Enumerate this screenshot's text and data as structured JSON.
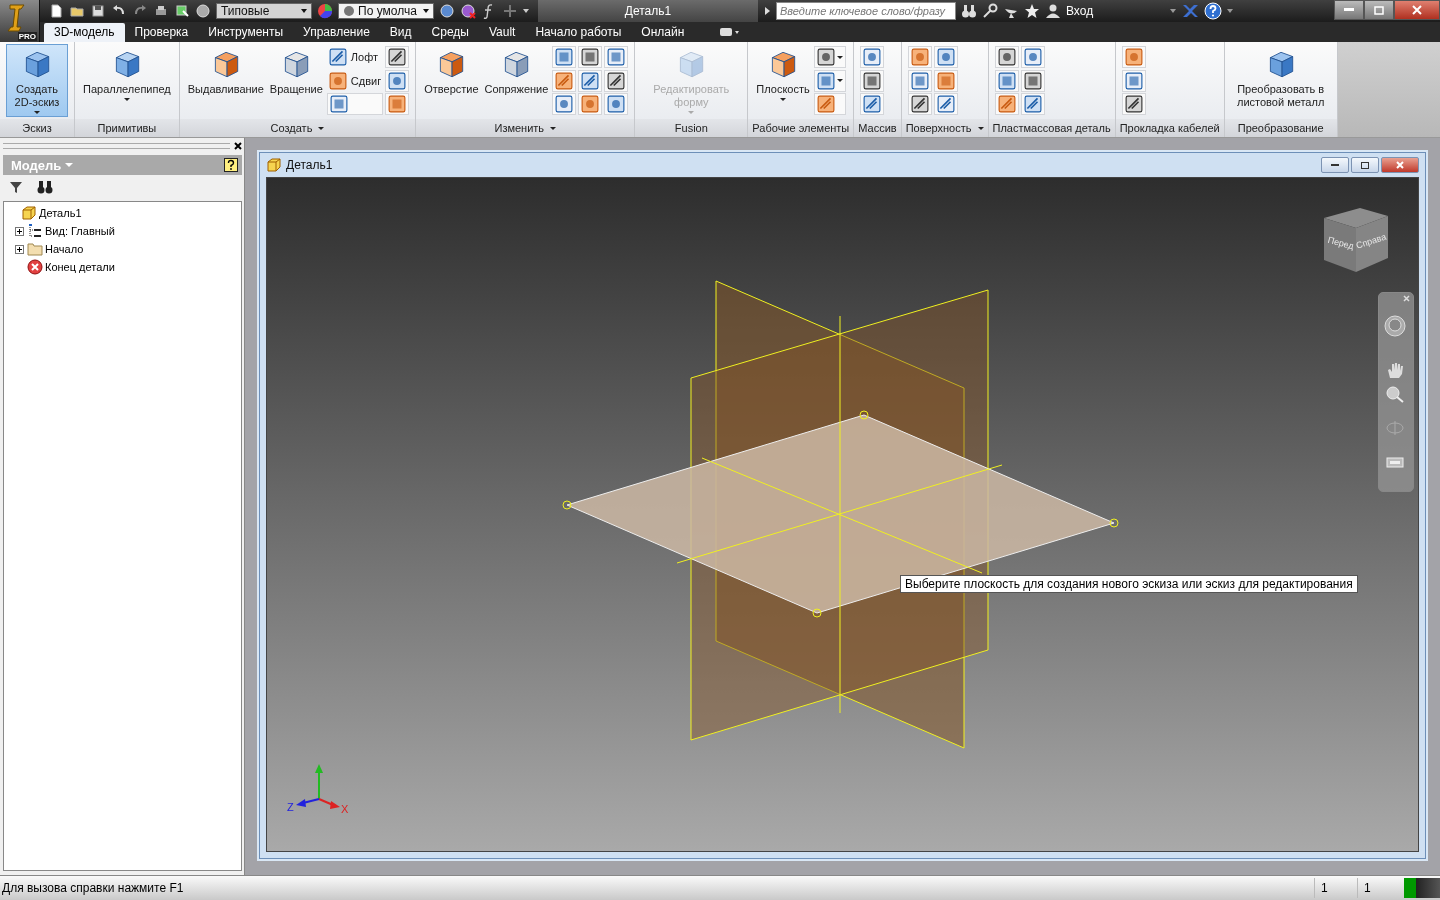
{
  "app_menu": {
    "edition": "PRO"
  },
  "quick_access": {
    "style_dropdown": "Типовые",
    "appearance_dropdown": "По умолча"
  },
  "window": {
    "title": "Деталь1"
  },
  "search": {
    "placeholder": "Введите ключевое слово/фразу"
  },
  "sign_in": "Вход",
  "tabs": [
    {
      "label": "3D-модель",
      "selected": true
    },
    {
      "label": "Проверка",
      "selected": false
    },
    {
      "label": "Инструменты",
      "selected": false
    },
    {
      "label": "Управление",
      "selected": false
    },
    {
      "label": "Вид",
      "selected": false
    },
    {
      "label": "Среды",
      "selected": false
    },
    {
      "label": "Vault",
      "selected": false
    },
    {
      "label": "Начало работы",
      "selected": false
    },
    {
      "label": "Онлайн",
      "selected": false
    }
  ],
  "ribbon": [
    {
      "title": "Эскиз",
      "menu": false,
      "items": [
        {
          "kind": "large",
          "label": "Создать 2D-эскиз",
          "selected": true,
          "disabled": false,
          "dropdown": true
        }
      ]
    },
    {
      "title": "Примитивы",
      "menu": false,
      "items": [
        {
          "kind": "large",
          "label": "Параллелепипед",
          "selected": false,
          "disabled": false,
          "dropdown": true
        }
      ]
    },
    {
      "title": "Создать",
      "menu": true,
      "items": [
        {
          "kind": "large",
          "label": "Выдавливание",
          "selected": false,
          "disabled": false,
          "dropdown": false
        },
        {
          "kind": "large",
          "label": "Вращение",
          "selected": false,
          "disabled": false,
          "dropdown": false
        },
        {
          "kind": "stack",
          "buttons": [
            {
              "kind": "labeled",
              "label": "Лофт"
            },
            {
              "kind": "labeled",
              "label": "Сдвиг"
            },
            {
              "kind": "icon"
            }
          ]
        },
        {
          "kind": "stack",
          "buttons": [
            {
              "kind": "icon"
            },
            {
              "kind": "icon"
            },
            {
              "kind": "icon"
            }
          ]
        }
      ]
    },
    {
      "title": "Изменить",
      "menu": true,
      "items": [
        {
          "kind": "large",
          "label": "Отверстие",
          "selected": false,
          "disabled": false,
          "dropdown": false
        },
        {
          "kind": "large",
          "label": "Сопряжение",
          "selected": false,
          "disabled": false,
          "dropdown": false
        },
        {
          "kind": "stack",
          "buttons": [
            {
              "kind": "icon"
            },
            {
              "kind": "icon"
            },
            {
              "kind": "icon"
            }
          ]
        },
        {
          "kind": "stack",
          "buttons": [
            {
              "kind": "icon"
            },
            {
              "kind": "icon"
            },
            {
              "kind": "icon"
            }
          ]
        },
        {
          "kind": "stack",
          "buttons": [
            {
              "kind": "icon"
            },
            {
              "kind": "icon"
            },
            {
              "kind": "icon"
            }
          ]
        }
      ]
    },
    {
      "title": "Fusion",
      "menu": false,
      "items": [
        {
          "kind": "large",
          "label": "Редактировать форму",
          "selected": false,
          "disabled": true,
          "dropdown": true
        }
      ]
    },
    {
      "title": "Рабочие элементы",
      "menu": false,
      "items": [
        {
          "kind": "large",
          "label": "Плоскость",
          "selected": false,
          "disabled": false,
          "dropdown": true
        },
        {
          "kind": "stack",
          "buttons": [
            {
              "kind": "icon",
              "dropdown": true
            },
            {
              "kind": "icon",
              "dropdown": true
            },
            {
              "kind": "icon"
            }
          ]
        }
      ]
    },
    {
      "title": "Массив",
      "menu": false,
      "items": [
        {
          "kind": "stack",
          "buttons": [
            {
              "kind": "icon"
            },
            {
              "kind": "icon"
            },
            {
              "kind": "icon"
            }
          ]
        }
      ]
    },
    {
      "title": "Поверхность",
      "menu": true,
      "items": [
        {
          "kind": "stack",
          "buttons": [
            {
              "kind": "icon"
            },
            {
              "kind": "icon"
            },
            {
              "kind": "icon"
            }
          ]
        },
        {
          "kind": "stack",
          "buttons": [
            {
              "kind": "icon"
            },
            {
              "kind": "icon"
            },
            {
              "kind": "icon"
            }
          ]
        }
      ]
    },
    {
      "title": "Пластмассовая деталь",
      "menu": false,
      "items": [
        {
          "kind": "stack",
          "buttons": [
            {
              "kind": "icon"
            },
            {
              "kind": "icon"
            },
            {
              "kind": "icon"
            }
          ]
        },
        {
          "kind": "stack",
          "buttons": [
            {
              "kind": "icon"
            },
            {
              "kind": "icon"
            },
            {
              "kind": "icon"
            }
          ]
        }
      ]
    },
    {
      "title": "Прокладка кабелей",
      "menu": false,
      "items": [
        {
          "kind": "stack",
          "buttons": [
            {
              "kind": "icon"
            },
            {
              "kind": "icon"
            },
            {
              "kind": "icon"
            }
          ]
        }
      ]
    },
    {
      "title": "Преобразование",
      "menu": false,
      "items": [
        {
          "kind": "large",
          "label": "Преобразовать в листовой металл",
          "selected": false,
          "disabled": false,
          "dropdown": false
        }
      ]
    }
  ],
  "browser": {
    "title": "Модель",
    "tree": [
      {
        "label": "Деталь1",
        "kind": "part",
        "collapsed": false,
        "children": [
          {
            "label": "Вид: Главный",
            "kind": "view",
            "collapsed": true
          },
          {
            "label": "Начало",
            "kind": "folder",
            "collapsed": true
          },
          {
            "label": "Конец детали",
            "kind": "end",
            "collapsed": false
          }
        ]
      }
    ]
  },
  "document": {
    "title": "Деталь1",
    "view_cube": {
      "faces": [
        "Перед",
        "Справа"
      ]
    },
    "axes": [
      "Z",
      "X"
    ],
    "tooltip": "Выберите плоскость для создания нового эскиза или эскиз для редактирования"
  },
  "status_bar": {
    "message": "Для вызова справки нажмите F1",
    "fields": [
      "1",
      "1"
    ]
  }
}
